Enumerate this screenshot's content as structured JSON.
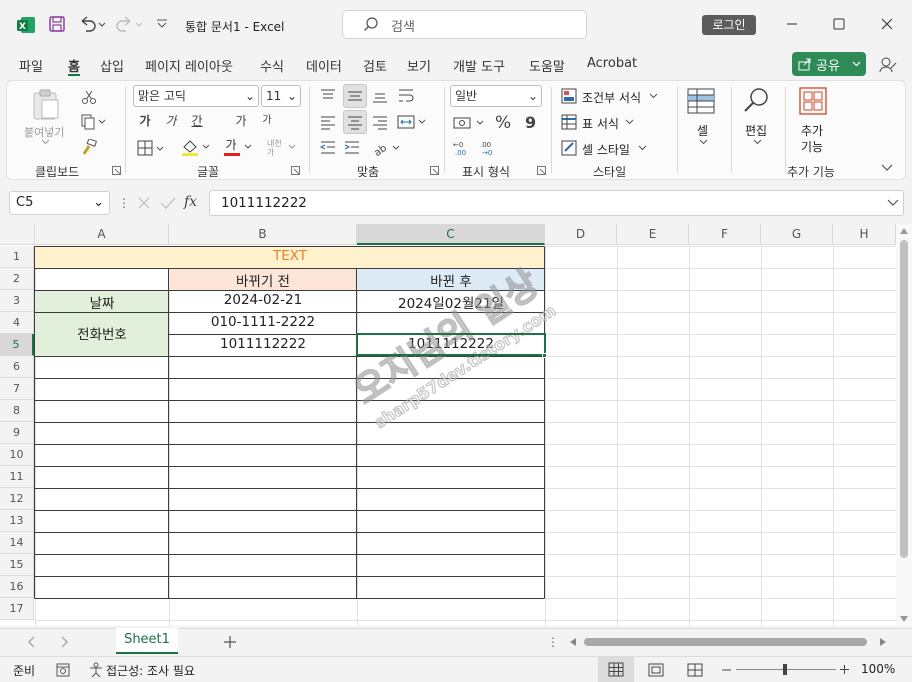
{
  "titlebar": {
    "title": "통합 문서1",
    "app": "Excel",
    "search_placeholder": "검색",
    "login_label": "로그인"
  },
  "tabs": [
    "파일",
    "홈",
    "삽입",
    "페이지 레이아웃",
    "수식",
    "데이터",
    "검토",
    "보기",
    "개발 도구",
    "도움말",
    "Acrobat"
  ],
  "share_label": "공유",
  "ribbon": {
    "groups": {
      "clipboard": "클립보드",
      "font": "글꼴",
      "alignment": "맞춤",
      "number": "표시 형식",
      "styles": "스타일",
      "addins": "추가 기능"
    },
    "paste_label": "붙여넣기",
    "font_name": "맑은 고딕",
    "font_size": "11",
    "number_format": "일반",
    "percent": "%",
    "comma": "9",
    "cond_format": "조건부 서식",
    "table_format": "표 서식",
    "cell_style": "셀 스타일",
    "cells_label": "셀",
    "editing_label": "편집",
    "addins_label1": "추가",
    "addins_label2": "기능",
    "font_btns": [
      "가",
      "가",
      "간",
      "가",
      "가"
    ],
    "fx": "fx"
  },
  "formula": {
    "namebox": "C5",
    "value": "1011112222"
  },
  "columns": [
    "A",
    "B",
    "C",
    "D",
    "E",
    "F",
    "G",
    "H"
  ],
  "rows": [
    "1",
    "2",
    "3",
    "4",
    "5",
    "6",
    "7",
    "8",
    "9",
    "10",
    "11",
    "12",
    "13",
    "14",
    "15",
    "16",
    "17"
  ],
  "cells": {
    "title": "TEXT",
    "header_before": "바뀌기 전",
    "header_after": "바뀐 후",
    "label_date": "날짜",
    "label_phone": "전화번호",
    "date_before": "2024-02-21",
    "date_after": "2024일02월21일",
    "phone1": "010-1111-2222",
    "phone2": "1011112222",
    "phone2_after": "1011112222"
  },
  "watermark": {
    "line1": "오지님의 일상",
    "line2": "sharp57dev.tistory.com"
  },
  "sheet_tab": "Sheet1",
  "status": {
    "ready": "준비",
    "accessibility": "접근성: 조사 필요",
    "zoom": "100%"
  },
  "colors": {
    "excel_green": "#1e7145",
    "title_fill": "#fff2cc",
    "title_text": "#ed7d31",
    "before_fill": "#fce4d6",
    "after_fill": "#ddebf7",
    "label_fill": "#e2efda"
  }
}
